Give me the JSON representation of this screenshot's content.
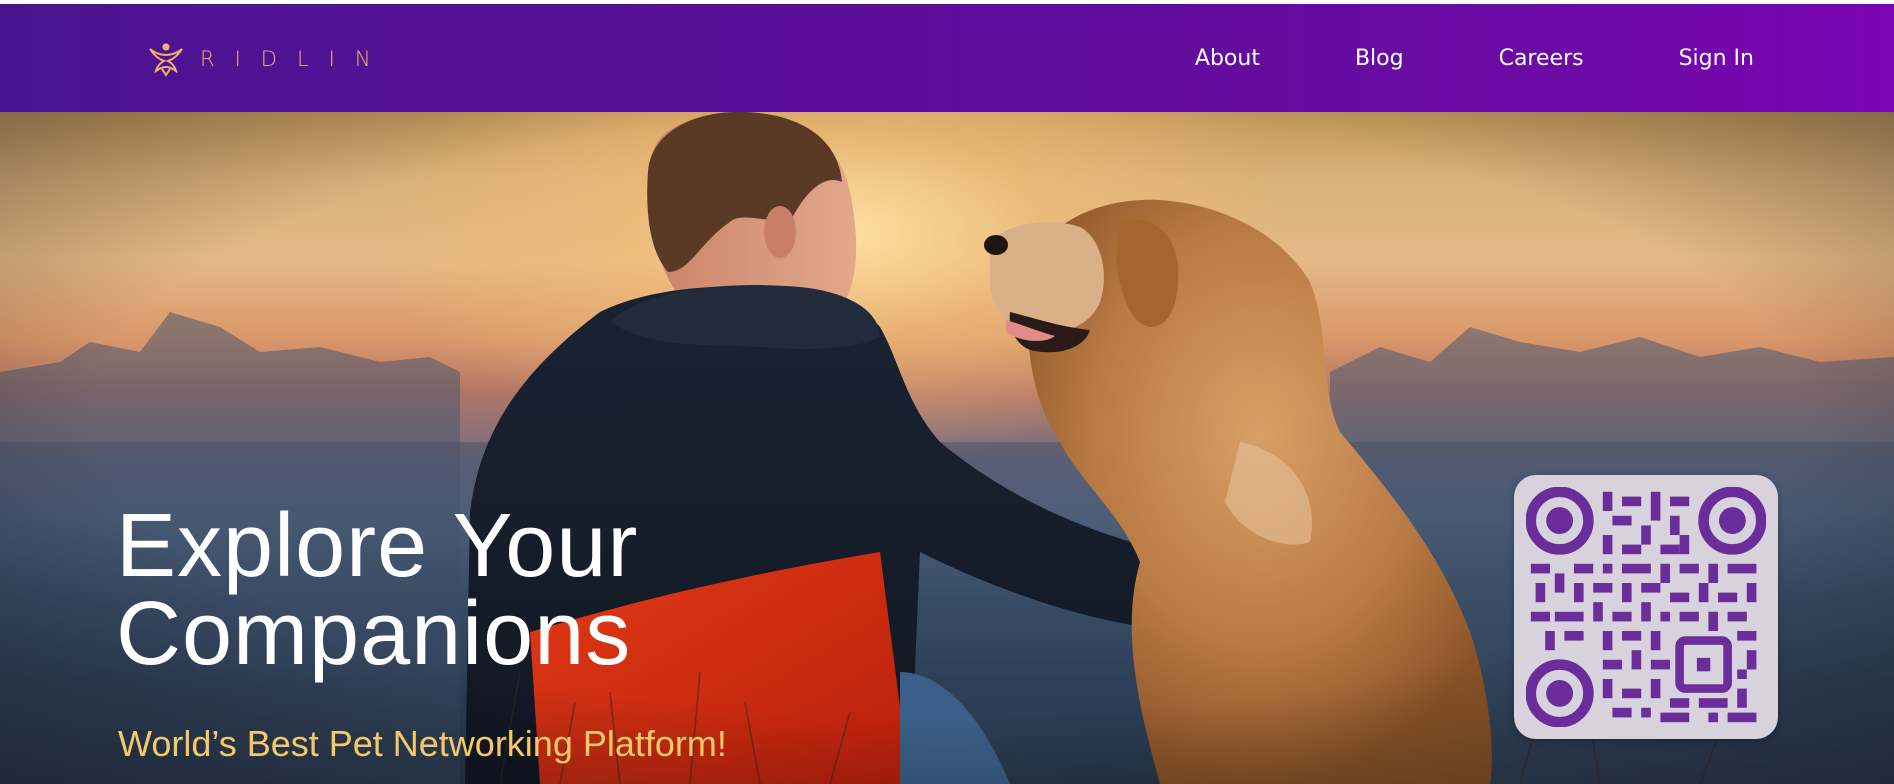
{
  "header": {
    "logo_text": "RIDLIN",
    "logo_icon": "ridlin-logo-mark",
    "nav": [
      {
        "label": "About"
      },
      {
        "label": "Blog"
      },
      {
        "label": "Careers"
      },
      {
        "label": "Sign In"
      }
    ],
    "colors": {
      "nav_gradient_start": "#4a1490",
      "nav_gradient_end": "#7a05b2",
      "logo_accent": "#f1b36c"
    }
  },
  "hero": {
    "title_line1": "Explore Your",
    "title_line2": "Companions",
    "subtitle": "World’s Best Pet Networking Platform!",
    "image_subject": "man-with-dog-at-sunset",
    "qr_icon": "qr-code",
    "colors": {
      "title": "#ffffff",
      "subtitle": "#f5c96a",
      "qr_modules": "#6a2d9a"
    }
  }
}
